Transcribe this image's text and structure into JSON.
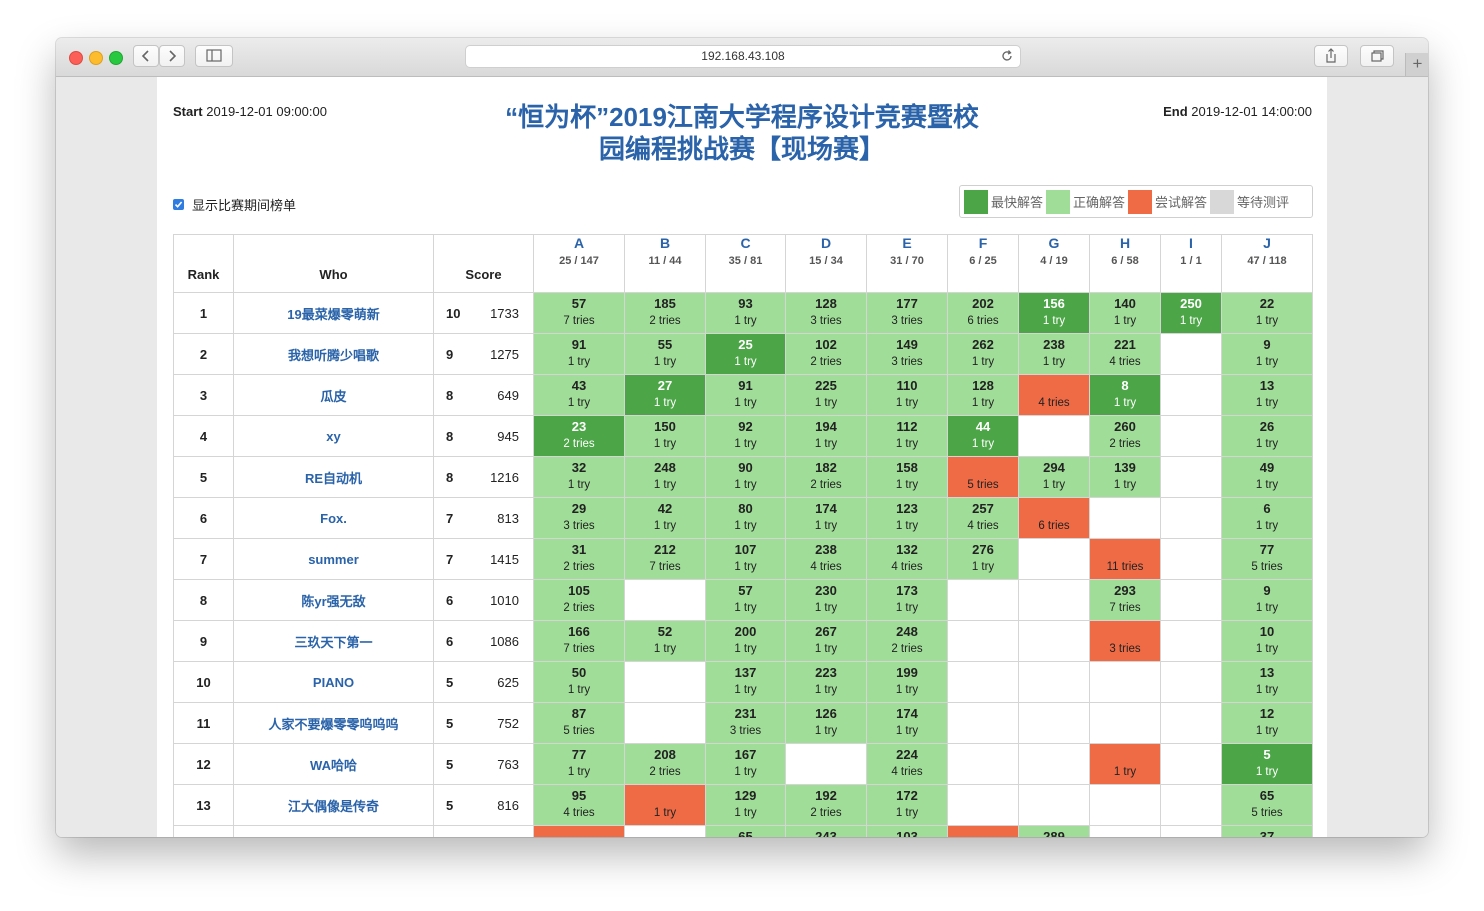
{
  "browser": {
    "url": "192.168.43.108"
  },
  "contest": {
    "start_label": "Start",
    "start_time": "2019-12-01 09:00:00",
    "end_label": "End",
    "end_time": "2019-12-01 14:00:00",
    "title_line1": "“恒为杯”2019江南大学程序设计竞赛暨校",
    "title_line2": "园编程挑战赛【现场赛】",
    "show_board_label": "显示比赛期间榜单",
    "show_board_checked": true
  },
  "legend": [
    {
      "label": "最快解答",
      "color": "#4ca647"
    },
    {
      "label": "正确解答",
      "color": "#a0dd98"
    },
    {
      "label": "尝试解答",
      "color": "#ee6b46"
    },
    {
      "label": "等待测评",
      "color": "#d8d8d8"
    }
  ],
  "headers": {
    "rank": "Rank",
    "who": "Who",
    "score": "Score"
  },
  "problems": [
    {
      "letter": "A",
      "stat": "25 / 147"
    },
    {
      "letter": "B",
      "stat": "11 / 44"
    },
    {
      "letter": "C",
      "stat": "35 / 81"
    },
    {
      "letter": "D",
      "stat": "15 / 34"
    },
    {
      "letter": "E",
      "stat": "31 / 70"
    },
    {
      "letter": "F",
      "stat": "6 / 25"
    },
    {
      "letter": "G",
      "stat": "4 / 19"
    },
    {
      "letter": "H",
      "stat": "6 / 58"
    },
    {
      "letter": "I",
      "stat": "1 / 1"
    },
    {
      "letter": "J",
      "stat": "47 / 118"
    }
  ],
  "rows": [
    {
      "rank": "1",
      "who": "19最菜爆零萌新",
      "solved": "10",
      "penalty": "1733",
      "cells": [
        {
          "s": "ac",
          "t": "57",
          "n": "7 tries"
        },
        {
          "s": "ac",
          "t": "185",
          "n": "2 tries"
        },
        {
          "s": "ac",
          "t": "93",
          "n": "1 try"
        },
        {
          "s": "ac",
          "t": "128",
          "n": "3 tries"
        },
        {
          "s": "ac",
          "t": "177",
          "n": "3 tries"
        },
        {
          "s": "ac",
          "t": "202",
          "n": "6 tries"
        },
        {
          "s": "fb",
          "t": "156",
          "n": "1 try"
        },
        {
          "s": "ac",
          "t": "140",
          "n": "1 try"
        },
        {
          "s": "fb",
          "t": "250",
          "n": "1 try"
        },
        {
          "s": "ac",
          "t": "22",
          "n": "1 try"
        }
      ]
    },
    {
      "rank": "2",
      "who": "我想听腾少唱歌",
      "solved": "9",
      "penalty": "1275",
      "cells": [
        {
          "s": "ac",
          "t": "91",
          "n": "1 try"
        },
        {
          "s": "ac",
          "t": "55",
          "n": "1 try"
        },
        {
          "s": "fb",
          "t": "25",
          "n": "1 try"
        },
        {
          "s": "ac",
          "t": "102",
          "n": "2 tries"
        },
        {
          "s": "ac",
          "t": "149",
          "n": "3 tries"
        },
        {
          "s": "ac",
          "t": "262",
          "n": "1 try"
        },
        {
          "s": "ac",
          "t": "238",
          "n": "1 try"
        },
        {
          "s": "ac",
          "t": "221",
          "n": "4 tries"
        },
        {
          "s": "empty"
        },
        {
          "s": "ac",
          "t": "9",
          "n": "1 try"
        }
      ]
    },
    {
      "rank": "3",
      "who": "瓜皮",
      "solved": "8",
      "penalty": "649",
      "cells": [
        {
          "s": "ac",
          "t": "43",
          "n": "1 try"
        },
        {
          "s": "fb",
          "t": "27",
          "n": "1 try"
        },
        {
          "s": "ac",
          "t": "91",
          "n": "1 try"
        },
        {
          "s": "ac",
          "t": "225",
          "n": "1 try"
        },
        {
          "s": "ac",
          "t": "110",
          "n": "1 try"
        },
        {
          "s": "ac",
          "t": "128",
          "n": "1 try"
        },
        {
          "s": "wa",
          "t": "",
          "n": "4 tries"
        },
        {
          "s": "fb",
          "t": "8",
          "n": "1 try"
        },
        {
          "s": "empty"
        },
        {
          "s": "ac",
          "t": "13",
          "n": "1 try"
        }
      ]
    },
    {
      "rank": "4",
      "who": "xy",
      "solved": "8",
      "penalty": "945",
      "cells": [
        {
          "s": "fb",
          "t": "23",
          "n": "2 tries"
        },
        {
          "s": "ac",
          "t": "150",
          "n": "1 try"
        },
        {
          "s": "ac",
          "t": "92",
          "n": "1 try"
        },
        {
          "s": "ac",
          "t": "194",
          "n": "1 try"
        },
        {
          "s": "ac",
          "t": "112",
          "n": "1 try"
        },
        {
          "s": "fb",
          "t": "44",
          "n": "1 try"
        },
        {
          "s": "empty"
        },
        {
          "s": "ac",
          "t": "260",
          "n": "2 tries"
        },
        {
          "s": "empty"
        },
        {
          "s": "ac",
          "t": "26",
          "n": "1 try"
        }
      ]
    },
    {
      "rank": "5",
      "who": "RE自动机",
      "solved": "8",
      "penalty": "1216",
      "cells": [
        {
          "s": "ac",
          "t": "32",
          "n": "1 try"
        },
        {
          "s": "ac",
          "t": "248",
          "n": "1 try"
        },
        {
          "s": "ac",
          "t": "90",
          "n": "1 try"
        },
        {
          "s": "ac",
          "t": "182",
          "n": "2 tries"
        },
        {
          "s": "ac",
          "t": "158",
          "n": "1 try"
        },
        {
          "s": "wa",
          "t": "",
          "n": "5 tries"
        },
        {
          "s": "ac",
          "t": "294",
          "n": "1 try"
        },
        {
          "s": "ac",
          "t": "139",
          "n": "1 try"
        },
        {
          "s": "empty"
        },
        {
          "s": "ac",
          "t": "49",
          "n": "1 try"
        }
      ]
    },
    {
      "rank": "6",
      "who": "Fox.",
      "solved": "7",
      "penalty": "813",
      "cells": [
        {
          "s": "ac",
          "t": "29",
          "n": "3 tries"
        },
        {
          "s": "ac",
          "t": "42",
          "n": "1 try"
        },
        {
          "s": "ac",
          "t": "80",
          "n": "1 try"
        },
        {
          "s": "ac",
          "t": "174",
          "n": "1 try"
        },
        {
          "s": "ac",
          "t": "123",
          "n": "1 try"
        },
        {
          "s": "ac",
          "t": "257",
          "n": "4 tries"
        },
        {
          "s": "wa",
          "t": "",
          "n": "6 tries"
        },
        {
          "s": "empty"
        },
        {
          "s": "empty"
        },
        {
          "s": "ac",
          "t": "6",
          "n": "1 try"
        }
      ]
    },
    {
      "rank": "7",
      "who": "summer",
      "solved": "7",
      "penalty": "1415",
      "cells": [
        {
          "s": "ac",
          "t": "31",
          "n": "2 tries"
        },
        {
          "s": "ac",
          "t": "212",
          "n": "7 tries"
        },
        {
          "s": "ac",
          "t": "107",
          "n": "1 try"
        },
        {
          "s": "ac",
          "t": "238",
          "n": "4 tries"
        },
        {
          "s": "ac",
          "t": "132",
          "n": "4 tries"
        },
        {
          "s": "ac",
          "t": "276",
          "n": "1 try"
        },
        {
          "s": "empty"
        },
        {
          "s": "wa",
          "t": "",
          "n": "11 tries"
        },
        {
          "s": "empty"
        },
        {
          "s": "ac",
          "t": "77",
          "n": "5 tries"
        }
      ]
    },
    {
      "rank": "8",
      "who": "陈yr强无敌",
      "solved": "6",
      "penalty": "1010",
      "cells": [
        {
          "s": "ac",
          "t": "105",
          "n": "2 tries"
        },
        {
          "s": "empty"
        },
        {
          "s": "ac",
          "t": "57",
          "n": "1 try"
        },
        {
          "s": "ac",
          "t": "230",
          "n": "1 try"
        },
        {
          "s": "ac",
          "t": "173",
          "n": "1 try"
        },
        {
          "s": "empty"
        },
        {
          "s": "empty"
        },
        {
          "s": "ac",
          "t": "293",
          "n": "7 tries"
        },
        {
          "s": "empty"
        },
        {
          "s": "ac",
          "t": "9",
          "n": "1 try"
        }
      ]
    },
    {
      "rank": "9",
      "who": "三玖天下第一",
      "solved": "6",
      "penalty": "1086",
      "cells": [
        {
          "s": "ac",
          "t": "166",
          "n": "7 tries"
        },
        {
          "s": "ac",
          "t": "52",
          "n": "1 try"
        },
        {
          "s": "ac",
          "t": "200",
          "n": "1 try"
        },
        {
          "s": "ac",
          "t": "267",
          "n": "1 try"
        },
        {
          "s": "ac",
          "t": "248",
          "n": "2 tries"
        },
        {
          "s": "empty"
        },
        {
          "s": "empty"
        },
        {
          "s": "wa",
          "t": "",
          "n": "3 tries"
        },
        {
          "s": "empty"
        },
        {
          "s": "ac",
          "t": "10",
          "n": "1 try"
        }
      ]
    },
    {
      "rank": "10",
      "who": "PIANO",
      "solved": "5",
      "penalty": "625",
      "cells": [
        {
          "s": "ac",
          "t": "50",
          "n": "1 try"
        },
        {
          "s": "empty"
        },
        {
          "s": "ac",
          "t": "137",
          "n": "1 try"
        },
        {
          "s": "ac",
          "t": "223",
          "n": "1 try"
        },
        {
          "s": "ac",
          "t": "199",
          "n": "1 try"
        },
        {
          "s": "empty"
        },
        {
          "s": "empty"
        },
        {
          "s": "empty"
        },
        {
          "s": "empty"
        },
        {
          "s": "ac",
          "t": "13",
          "n": "1 try"
        }
      ]
    },
    {
      "rank": "11",
      "who": "人家不要爆零零呜呜呜",
      "solved": "5",
      "penalty": "752",
      "cells": [
        {
          "s": "ac",
          "t": "87",
          "n": "5 tries"
        },
        {
          "s": "empty"
        },
        {
          "s": "ac",
          "t": "231",
          "n": "3 tries"
        },
        {
          "s": "ac",
          "t": "126",
          "n": "1 try"
        },
        {
          "s": "ac",
          "t": "174",
          "n": "1 try"
        },
        {
          "s": "empty"
        },
        {
          "s": "empty"
        },
        {
          "s": "empty"
        },
        {
          "s": "empty"
        },
        {
          "s": "ac",
          "t": "12",
          "n": "1 try"
        }
      ]
    },
    {
      "rank": "12",
      "who": "WA哈哈",
      "solved": "5",
      "penalty": "763",
      "cells": [
        {
          "s": "ac",
          "t": "77",
          "n": "1 try"
        },
        {
          "s": "ac",
          "t": "208",
          "n": "2 tries"
        },
        {
          "s": "ac",
          "t": "167",
          "n": "1 try"
        },
        {
          "s": "empty"
        },
        {
          "s": "ac",
          "t": "224",
          "n": "4 tries"
        },
        {
          "s": "empty"
        },
        {
          "s": "empty"
        },
        {
          "s": "wa",
          "t": "",
          "n": "1 try"
        },
        {
          "s": "empty"
        },
        {
          "s": "fb",
          "t": "5",
          "n": "1 try"
        }
      ]
    },
    {
      "rank": "13",
      "who": "江大偶像是传奇",
      "solved": "5",
      "penalty": "816",
      "cells": [
        {
          "s": "ac",
          "t": "95",
          "n": "4 tries"
        },
        {
          "s": "wa",
          "t": "",
          "n": "1 try"
        },
        {
          "s": "ac",
          "t": "129",
          "n": "1 try"
        },
        {
          "s": "ac",
          "t": "192",
          "n": "2 tries"
        },
        {
          "s": "ac",
          "t": "172",
          "n": "1 try"
        },
        {
          "s": "empty"
        },
        {
          "s": "empty"
        },
        {
          "s": "empty"
        },
        {
          "s": "empty"
        },
        {
          "s": "ac",
          "t": "65",
          "n": "5 tries"
        }
      ]
    },
    {
      "rank": "",
      "who": "",
      "solved": "",
      "penalty": "",
      "cells": [
        {
          "s": "wa",
          "t": "",
          "n": ""
        },
        {
          "s": "empty"
        },
        {
          "s": "ac",
          "t": "65",
          "n": ""
        },
        {
          "s": "ac",
          "t": "243",
          "n": ""
        },
        {
          "s": "ac",
          "t": "103",
          "n": ""
        },
        {
          "s": "wa",
          "t": "",
          "n": ""
        },
        {
          "s": "ac",
          "t": "289",
          "n": ""
        },
        {
          "s": "empty"
        },
        {
          "s": "empty"
        },
        {
          "s": "ac",
          "t": "37",
          "n": ""
        }
      ]
    }
  ]
}
